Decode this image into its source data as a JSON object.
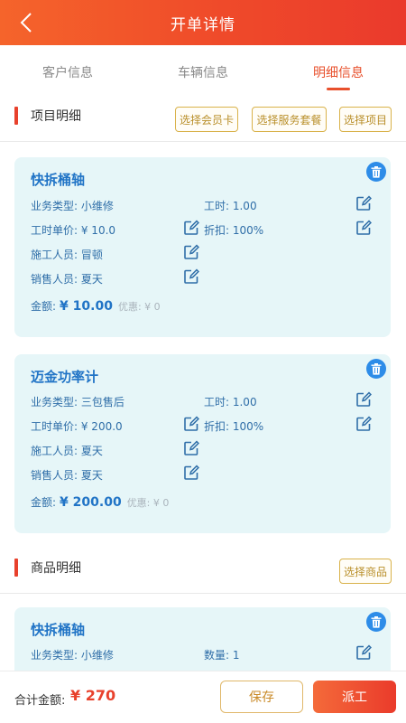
{
  "header": {
    "title": "开单详情",
    "back_icon": "chevron-left-icon"
  },
  "tabs": [
    {
      "label": "客户信息",
      "active": false
    },
    {
      "label": "车辆信息",
      "active": false
    },
    {
      "label": "明细信息",
      "active": true
    }
  ],
  "project_section": {
    "title": "项目明细",
    "buttons": [
      "选择会员卡",
      "选择服务套餐",
      "选择项目"
    ]
  },
  "project_items": [
    {
      "name": "快拆桶轴",
      "business_type": "业务类型: 小维修",
      "work_hours": "工时: 1.00",
      "unit_price": "工时单价: ¥ 10.0",
      "discount": "折扣: 100%",
      "worker": "施工人员: 冒顿",
      "sales": "销售人员: 夏天",
      "amount_label": "金额:",
      "amount_value": "¥ 10.00",
      "preferential": "优惠: ¥ 0"
    },
    {
      "name": "迈金功率计",
      "business_type": "业务类型: 三包售后",
      "work_hours": "工时: 1.00",
      "unit_price": "工时单价: ¥ 200.0",
      "discount": "折扣: 100%",
      "worker": "施工人员: 夏天",
      "sales": "销售人员: 夏天",
      "amount_label": "金额:",
      "amount_value": "¥ 200.00",
      "preferential": "优惠: ¥ 0"
    }
  ],
  "goods_section": {
    "title": "商品明细",
    "button": "选择商品"
  },
  "goods_items": [
    {
      "name": "快拆桶轴",
      "business_type": "业务类型: 小维修",
      "quantity": "数量: 1"
    }
  ],
  "footer": {
    "total_label": "合计金额:",
    "total_value": "¥ 270",
    "save_label": "保存",
    "dispatch_label": "派工"
  },
  "colors": {
    "header_gradient_start": "#f5642b",
    "header_gradient_end": "#ea3a2c",
    "accent": "#e8502c",
    "card_background": "#e6f6f8",
    "item_title": "#2174c6",
    "tag_border": "#d9b24a"
  }
}
